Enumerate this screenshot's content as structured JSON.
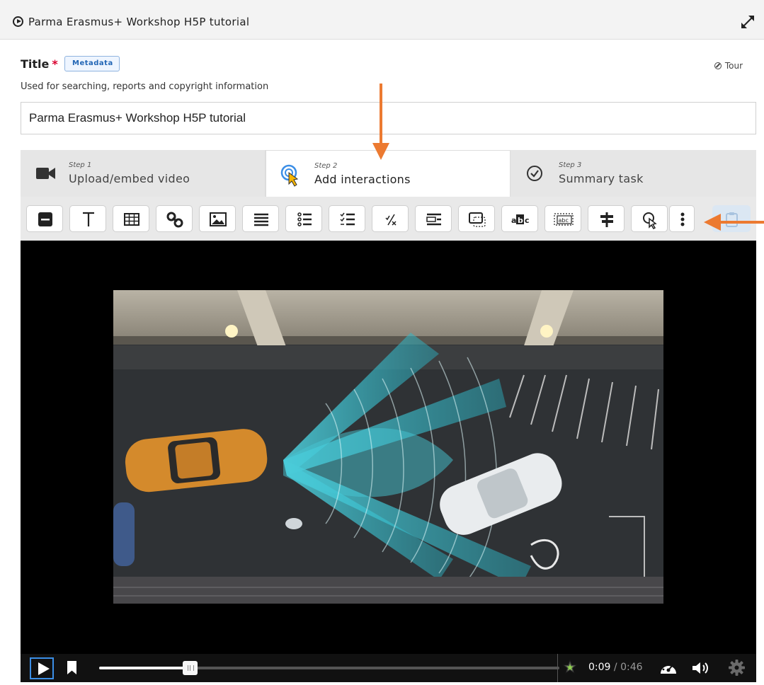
{
  "header": {
    "title": "Parma Erasmus+ Workshop H5P tutorial",
    "expand_icon": "expand-icon"
  },
  "form": {
    "title_label": "Title",
    "required_marker": "*",
    "metadata_button": "Metadata",
    "tour_label": "Tour",
    "description": "Used for searching, reports and copyright information",
    "title_value": "Parma Erasmus+ Workshop H5P tutorial"
  },
  "steps": [
    {
      "number": "Step 1",
      "name": "Upload/embed video",
      "icon": "video-camera-icon",
      "active": false
    },
    {
      "number": "Step 2",
      "name": "Add interactions",
      "icon": "pointer-click-icon",
      "active": true
    },
    {
      "number": "Step 3",
      "name": "Summary task",
      "icon": "checkmark-circle-icon",
      "active": false
    }
  ],
  "toolbar_tools": [
    "label-tool",
    "text-tool",
    "table-tool",
    "link-tool",
    "image-tool",
    "statements-tool",
    "single-choice-set-tool",
    "multiple-choice-tool",
    "true-false-tool",
    "fill-in-the-blanks-tool",
    "drag-and-drop-tool",
    "mark-the-words-tool",
    "drag-text-tool",
    "crossroads-tool",
    "navigation-hotspot-tool",
    "more-tools",
    "paste-tool"
  ],
  "player": {
    "current_time": "0:09",
    "separator": " / ",
    "total_time": "0:46",
    "progress_fraction": 0.196,
    "icons": [
      "play-icon",
      "bookmark-icon",
      "star-icon",
      "playback-speed-icon",
      "volume-icon",
      "settings-icon"
    ]
  },
  "colors": {
    "accent_orange": "#ec7a31",
    "required_red": "#d9002f",
    "active_blue": "#3b8ee6"
  }
}
